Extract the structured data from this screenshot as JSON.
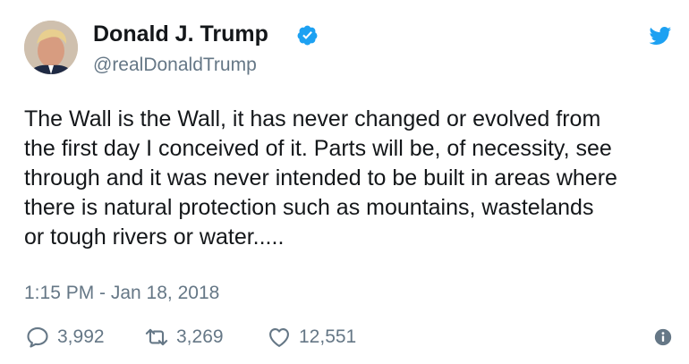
{
  "tweet": {
    "author": {
      "name": "Donald J. Trump",
      "handle": "@realDonaldTrump",
      "verified": true
    },
    "text_lines": [
      "The Wall is the Wall, it has never changed or evolved from",
      "the first day I conceived of it. Parts will be, of necessity, see",
      "through and it was never intended to be built in areas where",
      "there is natural protection such as mountains, wastelands",
      "or tough rivers or water....."
    ],
    "timestamp": "1:15 PM - Jan 18, 2018",
    "actions": {
      "replies": "3,992",
      "retweets": "3,269",
      "likes": "12,551"
    }
  },
  "colors": {
    "brand": "#1da1f2",
    "text": "#14171a",
    "muted": "#657786"
  },
  "icons": [
    "avatar",
    "verified-badge-icon",
    "twitter-bird-icon",
    "reply-icon",
    "retweet-icon",
    "like-heart-icon",
    "info-icon"
  ]
}
